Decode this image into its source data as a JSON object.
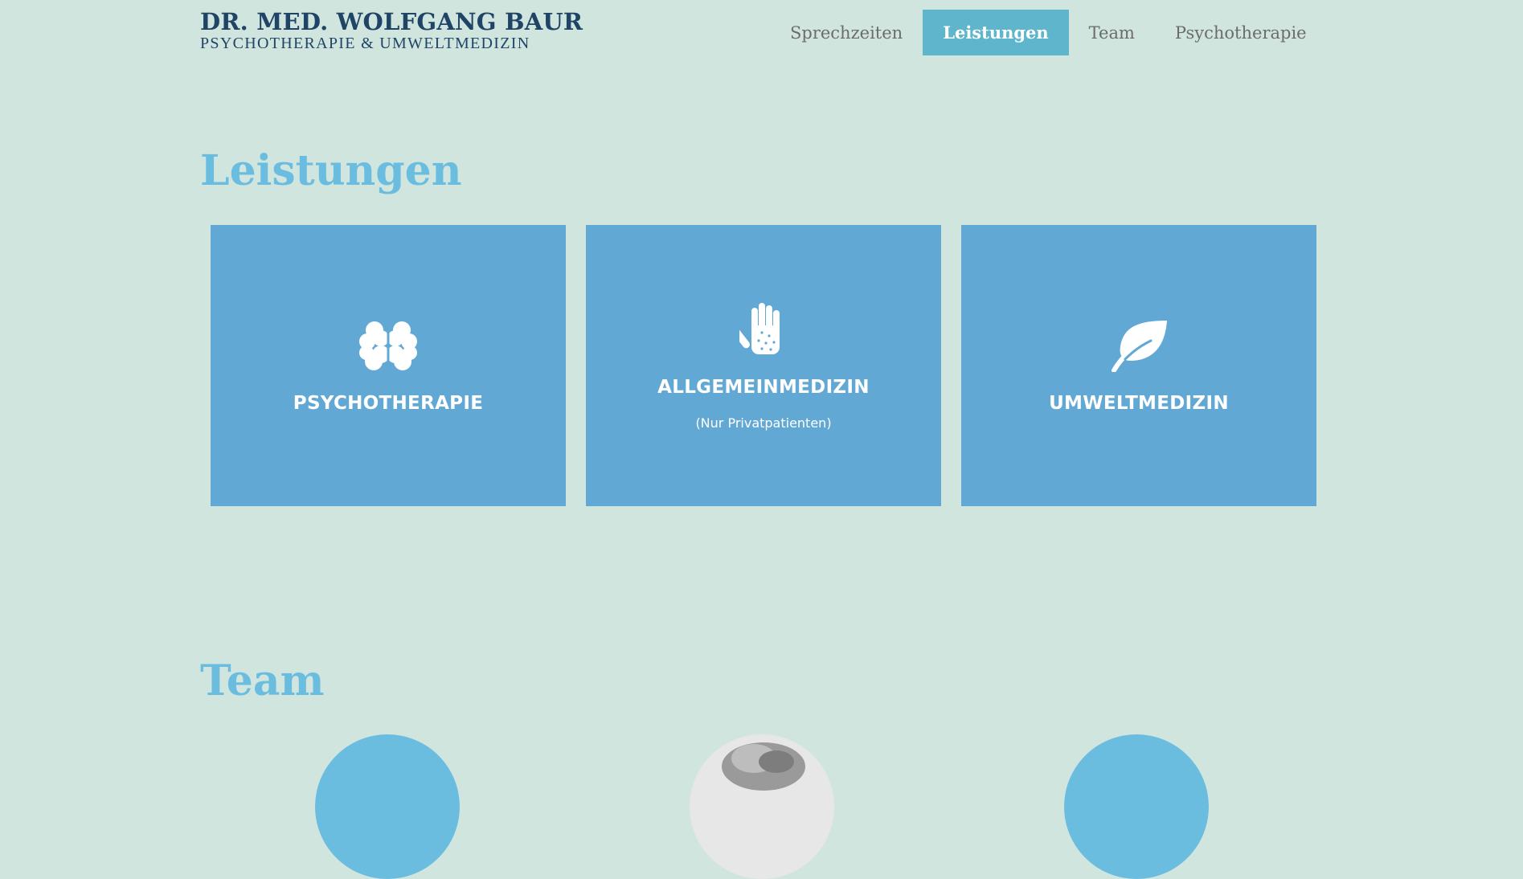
{
  "logo": {
    "name": "DR. MED. WOLFGANG BAUR",
    "subtitle": "PSYCHOTHERAPIE & UMWELTMEDIZIN"
  },
  "nav": {
    "items": [
      {
        "label": "Sprechzeiten"
      },
      {
        "label": "Leistungen",
        "active": true
      },
      {
        "label": "Team"
      },
      {
        "label": "Psychotherapie"
      }
    ]
  },
  "leistungen": {
    "title": "Leistungen",
    "cards": [
      {
        "title": "PSYCHOTHERAPIE",
        "icon": "brain-icon"
      },
      {
        "title": "ALLGEMEINMEDIZIN",
        "subtitle": "(Nur Privatpatienten)",
        "icon": "hand-icon"
      },
      {
        "title": "UMWELTMEDIZIN",
        "icon": "leaf-icon"
      }
    ]
  },
  "team": {
    "title": "Team"
  },
  "colors": {
    "background": "#d1e5df",
    "card": "#61a8d4",
    "nav_active": "#5fb6cc",
    "heading": "#6bbde0",
    "logo": "#1f4466"
  }
}
